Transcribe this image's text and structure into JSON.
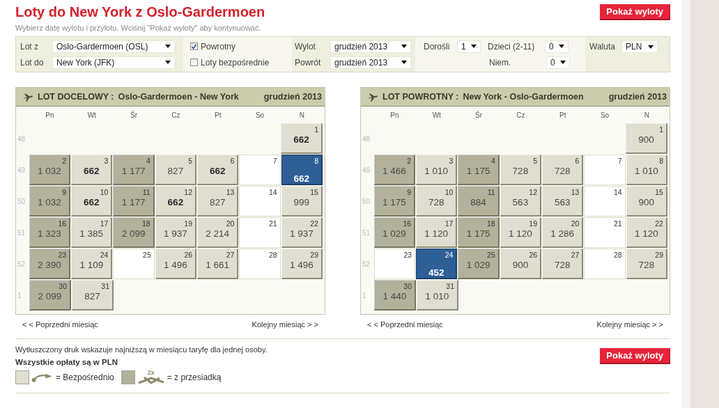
{
  "title": "Loty do New York z Oslo-Gardermoen",
  "subtitle": "Wybierz datę wylotu i przylotu. Wciśnij \"Pokaż wyloty\" aby kontynuować.",
  "show_button": "Pokaż wyloty",
  "search": {
    "from": {
      "label": "Lot z",
      "value": "Oslo-Gardermoen (OSL)"
    },
    "to": {
      "label": "Lot do",
      "value": "New York (JFK)"
    },
    "options": [
      {
        "label": "Powrotny",
        "checked": true
      },
      {
        "label": "Loty bezpośrednie",
        "checked": false
      }
    ],
    "departure": {
      "label": "Wylot",
      "value": "grudzień 2013"
    },
    "return": {
      "label": "Powrót",
      "value": "grudzień 2013"
    },
    "adults": {
      "label": "Dorośli",
      "value": "1"
    },
    "children": {
      "label": "Dzieci (2-11)",
      "value": "0"
    },
    "infants": {
      "label": "Niem.",
      "value": "0"
    },
    "currency": {
      "label": "Waluta",
      "value": "PLN"
    }
  },
  "calendars": [
    {
      "label": "LOT DOCELOWY :",
      "route": "Oslo-Gardermoen - New York",
      "month": "grudzień 2013",
      "weekdays": [
        "Pn",
        "Wt",
        "Śr",
        "Cz",
        "Pt",
        "So",
        "N"
      ],
      "weeks": [
        {
          "number": "48",
          "kind": "first",
          "days": [
            {
              "day": "1",
              "price": "662",
              "kind": "direct",
              "lowest": true,
              "selected": false
            }
          ]
        },
        {
          "number": "49",
          "days": [
            {
              "day": "2",
              "price": "1 032",
              "kind": "transfer",
              "lowest": false,
              "selected": false
            },
            {
              "day": "3",
              "price": "662",
              "kind": "direct",
              "lowest": true,
              "selected": false
            },
            {
              "day": "4",
              "price": "1 177",
              "kind": "transfer",
              "lowest": false,
              "selected": false
            },
            {
              "day": "5",
              "price": "827",
              "kind": "direct",
              "lowest": false,
              "selected": false
            },
            {
              "day": "6",
              "price": "662",
              "kind": "direct",
              "lowest": true,
              "selected": false
            },
            {
              "day": "7",
              "kind": "none",
              "selected": false
            },
            {
              "day": "8",
              "price": "662",
              "kind": "direct",
              "lowest": true,
              "selected": true
            }
          ]
        },
        {
          "number": "50",
          "days": [
            {
              "day": "9",
              "price": "1 032",
              "kind": "transfer",
              "lowest": false,
              "selected": false
            },
            {
              "day": "10",
              "price": "662",
              "kind": "direct",
              "lowest": true,
              "selected": false
            },
            {
              "day": "11",
              "price": "1 177",
              "kind": "transfer",
              "lowest": false,
              "selected": false
            },
            {
              "day": "12",
              "price": "662",
              "kind": "direct",
              "lowest": true,
              "selected": false
            },
            {
              "day": "13",
              "price": "827",
              "kind": "direct",
              "lowest": false,
              "selected": false
            },
            {
              "day": "14",
              "kind": "none",
              "selected": false
            },
            {
              "day": "15",
              "price": "999",
              "kind": "direct",
              "lowest": false,
              "selected": false
            }
          ]
        },
        {
          "number": "51",
          "days": [
            {
              "day": "16",
              "price": "1 323",
              "kind": "transfer",
              "lowest": false,
              "selected": false
            },
            {
              "day": "17",
              "price": "1 385",
              "kind": "direct",
              "lowest": false,
              "selected": false
            },
            {
              "day": "18",
              "price": "2 099",
              "kind": "transfer",
              "lowest": false,
              "selected": false
            },
            {
              "day": "19",
              "price": "1 937",
              "kind": "direct",
              "lowest": false,
              "selected": false
            },
            {
              "day": "20",
              "price": "2 214",
              "kind": "direct",
              "lowest": false,
              "selected": false
            },
            {
              "day": "21",
              "kind": "none",
              "selected": false
            },
            {
              "day": "22",
              "price": "1 937",
              "kind": "direct",
              "lowest": false,
              "selected": false
            }
          ]
        },
        {
          "number": "52",
          "days": [
            {
              "day": "23",
              "price": "2 390",
              "kind": "transfer",
              "lowest": false,
              "selected": false
            },
            {
              "day": "24",
              "price": "1 109",
              "kind": "direct",
              "lowest": false,
              "selected": false
            },
            {
              "day": "25",
              "kind": "none",
              "selected": false
            },
            {
              "day": "26",
              "price": "1 496",
              "kind": "direct",
              "lowest": false,
              "selected": false
            },
            {
              "day": "27",
              "price": "1 661",
              "kind": "direct",
              "lowest": false,
              "selected": false
            },
            {
              "day": "28",
              "kind": "none",
              "selected": false
            },
            {
              "day": "29",
              "price": "1 496",
              "kind": "direct",
              "lowest": false,
              "selected": false
            }
          ]
        },
        {
          "number": "1",
          "days": [
            {
              "day": "30",
              "price": "2 099",
              "kind": "transfer",
              "lowest": false,
              "selected": false
            },
            {
              "day": "31",
              "price": "827",
              "kind": "direct",
              "lowest": false,
              "selected": false
            }
          ]
        }
      ],
      "prev": "< < Poprzedni miesiąc",
      "next": "Kolejny miesiąc > >"
    },
    {
      "label": "LOT POWROTNY :",
      "route": "New York - Oslo-Gardermoen",
      "month": "grudzień 2013",
      "weekdays": [
        "Pn",
        "Wt",
        "Śr",
        "Cz",
        "Pt",
        "So",
        "N"
      ],
      "weeks": [
        {
          "number": "48",
          "kind": "first",
          "days": [
            {
              "day": "1",
              "price": "900",
              "kind": "direct",
              "lowest": false,
              "selected": false
            }
          ]
        },
        {
          "number": "49",
          "days": [
            {
              "day": "2",
              "price": "1 466",
              "kind": "transfer",
              "lowest": false,
              "selected": false
            },
            {
              "day": "3",
              "price": "1 010",
              "kind": "direct",
              "lowest": false,
              "selected": false
            },
            {
              "day": "4",
              "price": "1 175",
              "kind": "transfer",
              "lowest": false,
              "selected": false
            },
            {
              "day": "5",
              "price": "728",
              "kind": "direct",
              "lowest": false,
              "selected": false
            },
            {
              "day": "6",
              "price": "728",
              "kind": "direct",
              "lowest": false,
              "selected": false
            },
            {
              "day": "7",
              "kind": "none",
              "selected": false
            },
            {
              "day": "8",
              "price": "1 010",
              "kind": "direct",
              "lowest": false,
              "selected": false
            }
          ]
        },
        {
          "number": "50",
          "days": [
            {
              "day": "9",
              "price": "1 175",
              "kind": "transfer",
              "lowest": false,
              "selected": false
            },
            {
              "day": "10",
              "price": "728",
              "kind": "direct",
              "lowest": false,
              "selected": false
            },
            {
              "day": "11",
              "price": "884",
              "kind": "transfer",
              "lowest": false,
              "selected": false
            },
            {
              "day": "12",
              "price": "563",
              "kind": "direct",
              "lowest": false,
              "selected": false
            },
            {
              "day": "13",
              "price": "563",
              "kind": "direct",
              "lowest": false,
              "selected": false
            },
            {
              "day": "14",
              "kind": "none",
              "selected": false
            },
            {
              "day": "15",
              "price": "900",
              "kind": "direct",
              "lowest": false,
              "selected": false
            }
          ]
        },
        {
          "number": "51",
          "days": [
            {
              "day": "16",
              "price": "1 029",
              "kind": "transfer",
              "lowest": false,
              "selected": false
            },
            {
              "day": "17",
              "price": "1 120",
              "kind": "direct",
              "lowest": false,
              "selected": false
            },
            {
              "day": "18",
              "price": "1 175",
              "kind": "transfer",
              "lowest": false,
              "selected": false
            },
            {
              "day": "19",
              "price": "1 120",
              "kind": "direct",
              "lowest": false,
              "selected": false
            },
            {
              "day": "20",
              "price": "1 286",
              "kind": "direct",
              "lowest": false,
              "selected": false
            },
            {
              "day": "21",
              "kind": "none",
              "selected": false
            },
            {
              "day": "22",
              "price": "1 120",
              "kind": "direct",
              "lowest": false,
              "selected": false
            }
          ]
        },
        {
          "number": "52",
          "days": [
            {
              "day": "23",
              "kind": "none",
              "selected": false
            },
            {
              "day": "24",
              "price": "452",
              "kind": "direct",
              "lowest": true,
              "selected": true
            },
            {
              "day": "25",
              "price": "1 029",
              "kind": "transfer",
              "lowest": false,
              "selected": false
            },
            {
              "day": "26",
              "price": "900",
              "kind": "direct",
              "lowest": false,
              "selected": false
            },
            {
              "day": "27",
              "price": "728",
              "kind": "direct",
              "lowest": false,
              "selected": false
            },
            {
              "day": "28",
              "kind": "none",
              "selected": false
            },
            {
              "day": "29",
              "price": "728",
              "kind": "direct",
              "lowest": false,
              "selected": false
            }
          ]
        },
        {
          "number": "1",
          "days": [
            {
              "day": "30",
              "price": "1 440",
              "kind": "transfer",
              "lowest": false,
              "selected": false
            },
            {
              "day": "31",
              "price": "1 010",
              "kind": "direct",
              "lowest": false,
              "selected": false
            }
          ]
        }
      ],
      "prev": "< < Poprzedni miesiąc",
      "next": "Kolejny miesiąc > >"
    }
  ],
  "footer": {
    "note": "Wytłuszczony druk wskazuje najniższą w miesiącu taryfę dla jednej osoby.",
    "currency_note": "Wszystkie opłaty są w PLN",
    "legend": [
      {
        "kind": "direct",
        "label": "= Bezpośrednio"
      },
      {
        "kind": "transfer",
        "badge": "2x",
        "label": "= z przesiadką"
      }
    ]
  },
  "bottom_button": "Pokaż wyloty"
}
